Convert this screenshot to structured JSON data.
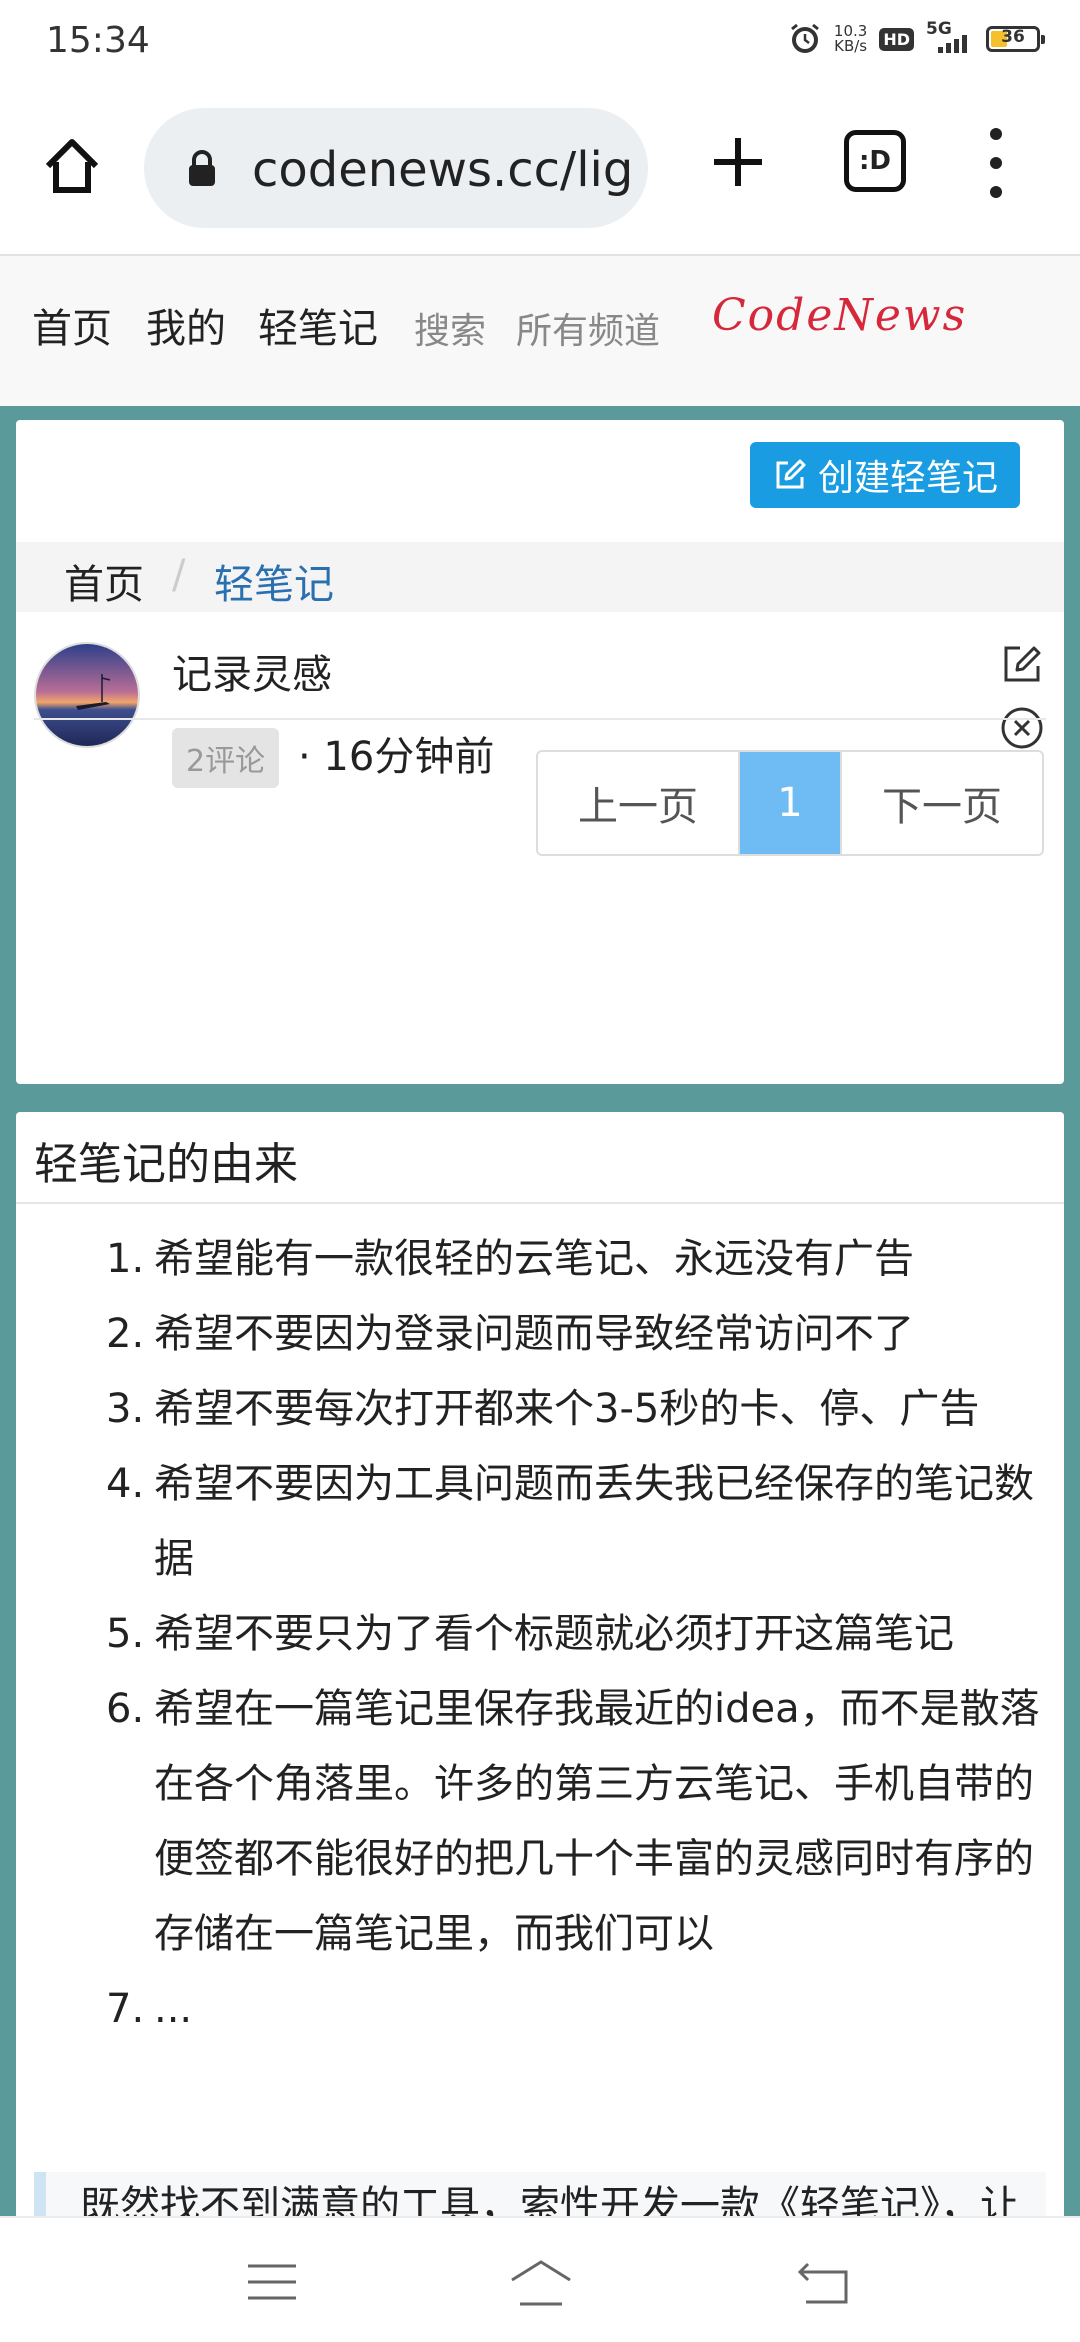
{
  "status_bar": {
    "time": "15:34",
    "speed_value": "10.3",
    "speed_unit": "KB/s",
    "hd": "HD",
    "network": "5G",
    "battery": "36",
    "battery_level": 0.36,
    "icons": [
      "alarm-icon",
      "hd-icon",
      "signal-icon",
      "battery-icon"
    ]
  },
  "browser": {
    "url": "codenews.cc/lig",
    "tabs_label": ":D",
    "icons": [
      "home-icon",
      "lock-icon",
      "plus-icon",
      "tabs-icon",
      "more-icon"
    ]
  },
  "site_nav": {
    "items": [
      "首页",
      "我的",
      "轻笔记"
    ],
    "muted_items": [
      "搜索",
      "所有频道"
    ],
    "logo": "CodeNews",
    "logo_color": "#d6283b"
  },
  "card1": {
    "create_button": "创建轻笔记",
    "breadcrumb": {
      "home": "首页",
      "separator": "/",
      "current": "轻笔记"
    },
    "note": {
      "title": "记录灵感",
      "comments": "2评论",
      "time": "· 16分钟前"
    },
    "pagination": {
      "prev": "上一页",
      "current": "1",
      "next": "下一页"
    }
  },
  "card2": {
    "title": "轻笔记的由来",
    "items": [
      {
        "num": "1.",
        "text": "希望能有一款很轻的云笔记、永远没有广告"
      },
      {
        "num": "2.",
        "text": "希望不要因为登录问题而导致经常访问不了"
      },
      {
        "num": "3.",
        "text": "希望不要每次打开都来个3-5秒的卡、停、广告"
      },
      {
        "num": "4.",
        "text": "希望不要因为工具问题而丢失我已经保存的笔记数据"
      },
      {
        "num": "5.",
        "text": "希望不要只为了看个标题就必须打开这篇笔记"
      },
      {
        "num": "6.",
        "text": "希望在一篇笔记里保存我最近的idea，而不是散落在各个角落里。许多的第三方云笔记、手机自带的便签都不能很好的把几十个丰富的灵感同时有序的存储在一篇笔记里，而我们可以"
      },
      {
        "num": "7.",
        "text": "..."
      }
    ],
    "quote": "既然找不到满意的工具，索性开发一款《轻笔记》，让瞬间的灵感(短文字、idea列表、图片、链接等)更容易被记录"
  },
  "colors": {
    "teal_background": "#5a9a9a",
    "accent_blue": "#1a9ce2",
    "page_active": "#6fbcf5",
    "link_blue": "#2a6fb0"
  }
}
